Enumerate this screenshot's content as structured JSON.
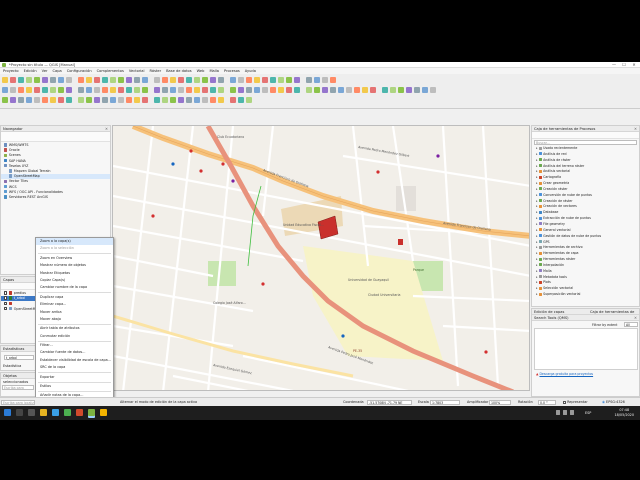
{
  "window": {
    "title": "*Proyecto sin título — QGIS [Manual]",
    "minimize": "—",
    "maximize": "☐",
    "close": "✕"
  },
  "menus": [
    "Proyecto",
    "Edición",
    "Ver",
    "Capa",
    "Configuración",
    "Complementos",
    "Vectorial",
    "Ráster",
    "Base de datos",
    "Web",
    "Malla",
    "Procesos",
    "Ayuda"
  ],
  "navigator": {
    "title": "Navegador",
    "items": [
      {
        "label": "WMS/WMTS",
        "icon": "wms-icon",
        "color": "#6d8fbf",
        "indent": 0
      },
      {
        "label": "Oracle",
        "icon": "database-icon",
        "color": "#c0504d",
        "indent": 0
      },
      {
        "label": "Scenes",
        "icon": "scene-icon",
        "color": "#8bb04a",
        "indent": 0
      },
      {
        "label": "SAP HANA",
        "icon": "database-icon",
        "color": "#3b82c4",
        "indent": 0
      },
      {
        "label": "Teselas XYZ",
        "icon": "xyz-tiles-icon",
        "color": "#6d8fbf",
        "indent": 0
      },
      {
        "label": "Mapzen Global Terrain",
        "icon": "xyz-tiles-icon",
        "color": "#7a9cc6",
        "indent": 1
      },
      {
        "label": "OpenStreetMap",
        "icon": "xyz-tiles-icon",
        "color": "#7a9cc6",
        "indent": 1
      },
      {
        "label": "Vector Tiles",
        "icon": "vector-tiles-icon",
        "color": "#8a6fb0",
        "indent": 0
      },
      {
        "label": "WCS",
        "icon": "wcs-icon",
        "color": "#5c9bd1",
        "indent": 0
      },
      {
        "label": "WFS / OGC API - Funcionalidades",
        "icon": "wfs-icon",
        "color": "#5c9bd1",
        "indent": 0
      },
      {
        "label": "Servidores REST ArcGIS",
        "icon": "arcgis-icon",
        "color": "#4a8fc4",
        "indent": 0
      }
    ]
  },
  "layers": {
    "title": "Capas",
    "items": [
      {
        "label": "predios",
        "color": "#c0392b",
        "checked": true
      },
      {
        "label": "t_arbol",
        "color": "#2e7d32",
        "checked": true
      },
      {
        "label": "",
        "color": "#c0392b",
        "checked": true
      },
      {
        "label": "OpenStreetMap",
        "color": "#7a9cc6",
        "checked": true
      }
    ]
  },
  "stats_panel": {
    "title": "Estadísticas",
    "value": "t_arbol"
  },
  "edit_panel": {
    "title": "Estadística"
  },
  "objects_panel": {
    "title": "Objetos seleccionados",
    "search_placeholder": "Escriba para localizar (Ctrl+K)"
  },
  "context_menu": {
    "items": [
      {
        "label": "Zoom a la capa(s)",
        "state": "normal"
      },
      {
        "label": "Zoom a la selección",
        "state": "disabled"
      },
      {
        "label": "Zoom en Overview",
        "state": "normal"
      },
      {
        "label": "Mostrar número de objetos",
        "state": "normal"
      },
      {
        "label": "Mostrar Etiquetas",
        "state": "normal"
      },
      {
        "label": "Copiar Capa(s)",
        "state": "normal"
      },
      {
        "label": "Cambiar nombre de la capa",
        "state": "normal"
      },
      {
        "label": "Duplicar capa",
        "state": "normal"
      },
      {
        "label": "Eliminar capa...",
        "state": "normal"
      },
      {
        "label": "Mover arriba",
        "state": "normal"
      },
      {
        "label": "Mover abajo",
        "state": "normal"
      },
      {
        "label": "Abrir tabla de atributos",
        "state": "normal"
      },
      {
        "label": "Conmutar edición",
        "state": "normal"
      },
      {
        "label": "Filtrar...",
        "state": "normal"
      },
      {
        "label": "Cambiar fuente de datos...",
        "state": "normal"
      },
      {
        "label": "Establecer visibilidad de escala de capa...",
        "state": "normal"
      },
      {
        "label": "SRC de la capa",
        "state": "normal"
      },
      {
        "label": "Exportar",
        "state": "normal"
      },
      {
        "label": "Estilos",
        "state": "normal"
      },
      {
        "label": "Añadir notas de la capa...",
        "state": "normal"
      },
      {
        "label": "Propiedades...",
        "state": "normal"
      }
    ],
    "separators_after": [
      1,
      6,
      10,
      12,
      16,
      17,
      18
    ]
  },
  "processing": {
    "title": "Caja de herramientas de Procesos",
    "search_placeholder": "Buscar...",
    "items": [
      {
        "label": "Usado recientemente",
        "color": "#9e9e9e"
      },
      {
        "label": "Análisis de red",
        "color": "#4a90d9"
      },
      {
        "label": "Análisis de ráster",
        "color": "#6aa84f"
      },
      {
        "label": "Análisis del terreno ráster",
        "color": "#6aa84f"
      },
      {
        "label": "Análisis vectorial",
        "color": "#e69138"
      },
      {
        "label": "Cartografía",
        "color": "#cc4125"
      },
      {
        "label": "Crear geometría",
        "color": "#e69138"
      },
      {
        "label": "Creación ráster",
        "color": "#6aa84f"
      },
      {
        "label": "Conversión de nube de puntos",
        "color": "#4a90d9"
      },
      {
        "label": "Creación de ráster",
        "color": "#6aa84f"
      },
      {
        "label": "Creación de vectores",
        "color": "#e69138"
      },
      {
        "label": "Database",
        "color": "#3d85c6"
      },
      {
        "label": "Extracción de nube de puntos",
        "color": "#4a90d9"
      },
      {
        "label": "File geometry",
        "color": "#8e7cc3"
      },
      {
        "label": "General vectorial",
        "color": "#e69138"
      },
      {
        "label": "Gestión de datos de nube de puntos",
        "color": "#4a90d9"
      },
      {
        "label": "GPS",
        "color": "#76a5af"
      },
      {
        "label": "Herramientas de archivo",
        "color": "#999999"
      },
      {
        "label": "Herramientas de capa",
        "color": "#e69138"
      },
      {
        "label": "Herramientas ráster",
        "color": "#6aa84f"
      },
      {
        "label": "Interpolación",
        "color": "#6aa84f"
      },
      {
        "label": "Malla",
        "color": "#8e7cc3"
      },
      {
        "label": "Metadata tools",
        "color": "#999999"
      },
      {
        "label": "Plots",
        "color": "#cc4125"
      },
      {
        "label": "Selección vectorial",
        "color": "#e69138"
      },
      {
        "label": "Superposición vectorial",
        "color": "#e69138"
      }
    ]
  },
  "results": {
    "title": "Edición de capas",
    "tab_label": "Caja de herramientas de Procesos",
    "search_title": "Search Tools (QMS)",
    "filter_label": "Filtrar by extent",
    "filter_value": "All"
  },
  "news": {
    "text": "Descarga gratuita para proyectos",
    "link": "Descarga gratuita"
  },
  "status": {
    "locator": "Escriba para localizar (Ctrl+K)",
    "message": "Alternar el modo de edición de la capa activa",
    "coord_label": "Coordenada",
    "coord_value": "-51.5708N -71.79 NE",
    "scale_label": "Escala",
    "scale_value": "1:7803",
    "magnifier_label": "Amplificador",
    "magnifier_value": "100%",
    "rotation_label": "Rotación",
    "rotation_value": "0.0 °",
    "render_label": "Representar",
    "crs_value": "EPSG:4326"
  },
  "clock": {
    "time": "07:48",
    "date": "18/05/2020"
  },
  "tray": {
    "lang": "ESP"
  },
  "map": {
    "labels": [
      {
        "text": "Club Ecuatoriano",
        "kind": "poi"
      },
      {
        "text": "Avenida Francisco de Orellana",
        "kind": "street"
      },
      {
        "text": "Avenida Francisco de Orellana",
        "kind": "street"
      },
      {
        "text": "Avenida Pedro Menéndez Gilbert",
        "kind": "street"
      },
      {
        "text": "Unidad Educativa Fiscal...",
        "kind": "poi"
      },
      {
        "text": "Colegio José Alfaro...",
        "kind": "poi"
      },
      {
        "text": "Avenida Pedro José Menéndez",
        "kind": "street"
      },
      {
        "text": "PE-35",
        "kind": "route"
      },
      {
        "text": "Avenida Ezequiel Gómez",
        "kind": "street"
      },
      {
        "text": "Universidad de Guayaquil",
        "kind": "poi"
      },
      {
        "text": "Parque",
        "kind": "poi"
      },
      {
        "text": "Ciudad Universitaria",
        "kind": "poi"
      }
    ]
  }
}
